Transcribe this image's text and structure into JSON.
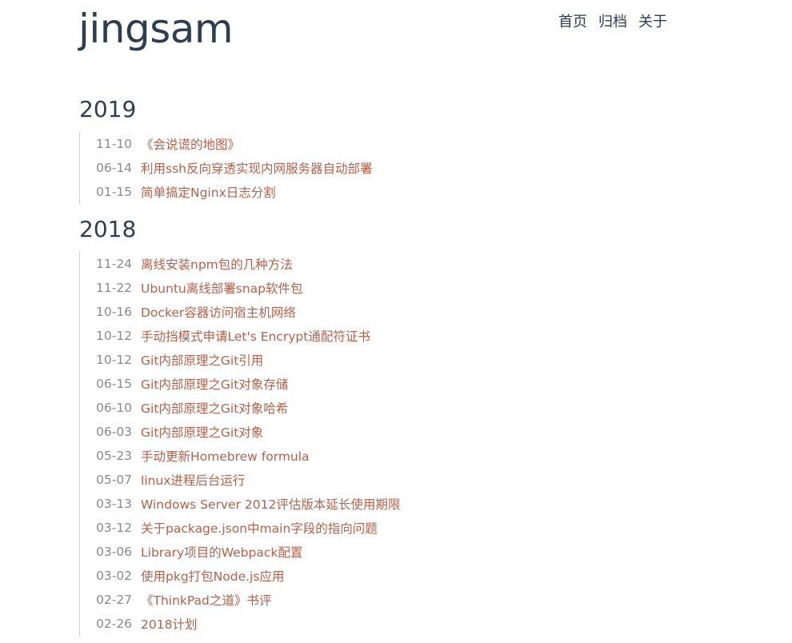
{
  "header": {
    "title": "jingsam",
    "nav": [
      "首页",
      "归档",
      "关于"
    ]
  },
  "archive": [
    {
      "year": "2019",
      "posts": [
        {
          "date": "11-10",
          "title": "《会说谎的地图》"
        },
        {
          "date": "06-14",
          "title": "利用ssh反向穿透实现内网服务器自动部署"
        },
        {
          "date": "01-15",
          "title": "简单搞定Nginx日志分割"
        }
      ]
    },
    {
      "year": "2018",
      "posts": [
        {
          "date": "11-24",
          "title": "离线安装npm包的几种方法"
        },
        {
          "date": "11-22",
          "title": "Ubuntu离线部署snap软件包"
        },
        {
          "date": "10-16",
          "title": "Docker容器访问宿主机网络"
        },
        {
          "date": "10-12",
          "title": "手动挡模式申请Let's Encrypt通配符证书"
        },
        {
          "date": "10-12",
          "title": "Git内部原理之Git引用"
        },
        {
          "date": "06-15",
          "title": "Git内部原理之Git对象存储"
        },
        {
          "date": "06-10",
          "title": "Git内部原理之Git对象哈希"
        },
        {
          "date": "06-03",
          "title": "Git内部原理之Git对象"
        },
        {
          "date": "05-23",
          "title": "手动更新Homebrew formula"
        },
        {
          "date": "05-07",
          "title": "linux进程后台运行"
        },
        {
          "date": "03-13",
          "title": "Windows Server 2012评估版本延长使用期限"
        },
        {
          "date": "03-12",
          "title": "关于package.json中main字段的指向问题"
        },
        {
          "date": "03-06",
          "title": "Library项目的Webpack配置"
        },
        {
          "date": "03-02",
          "title": "使用pkg打包Node.js应用"
        },
        {
          "date": "02-27",
          "title": "《ThinkPad之道》书评"
        },
        {
          "date": "02-26",
          "title": "2018计划"
        }
      ]
    }
  ]
}
